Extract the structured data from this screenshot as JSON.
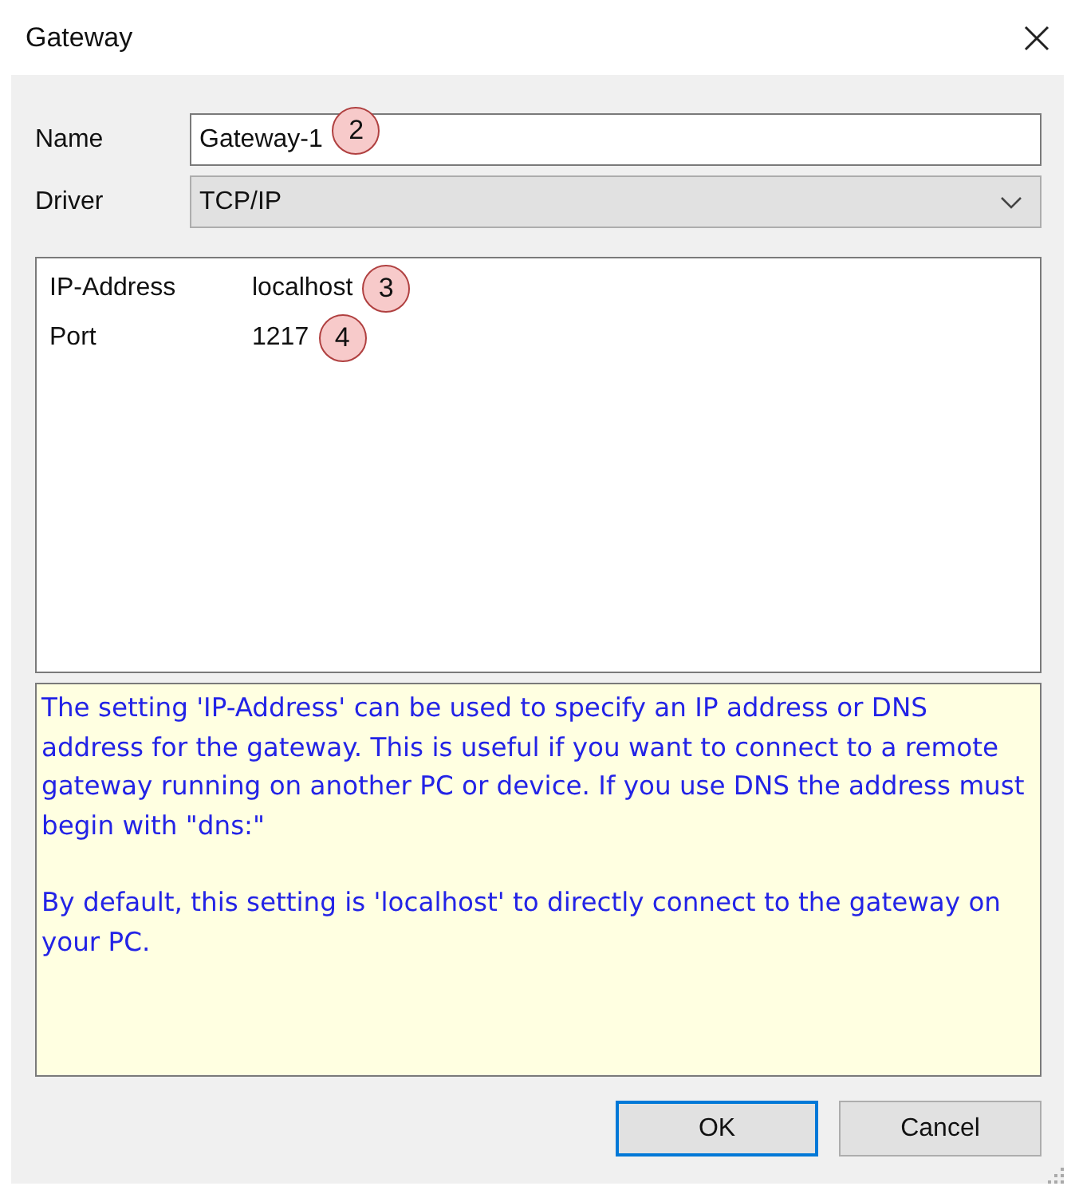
{
  "window": {
    "title": "Gateway"
  },
  "fields": [
    {
      "label": "Name",
      "kind": "text",
      "value": "Gateway-1",
      "callout": "2"
    },
    {
      "label": "Driver",
      "kind": "dropdown",
      "value": "TCP/IP"
    }
  ],
  "properties": [
    {
      "name": "IP-Address",
      "value": "localhost",
      "callout": "3"
    },
    {
      "name": "Port",
      "value": "1217",
      "callout": "4"
    }
  ],
  "help": [
    "The setting 'IP-Address' can be used to specify an IP address or DNS address for the gateway. This is useful if you want to connect to a remote gateway running on another PC or device. If you use DNS the address must begin with \"dns:\"",
    "By default, this setting is 'localhost' to directly connect to the gateway on your PC."
  ],
  "buttons": [
    {
      "label": "OK",
      "default": true
    },
    {
      "label": "Cancel",
      "default": false
    }
  ]
}
